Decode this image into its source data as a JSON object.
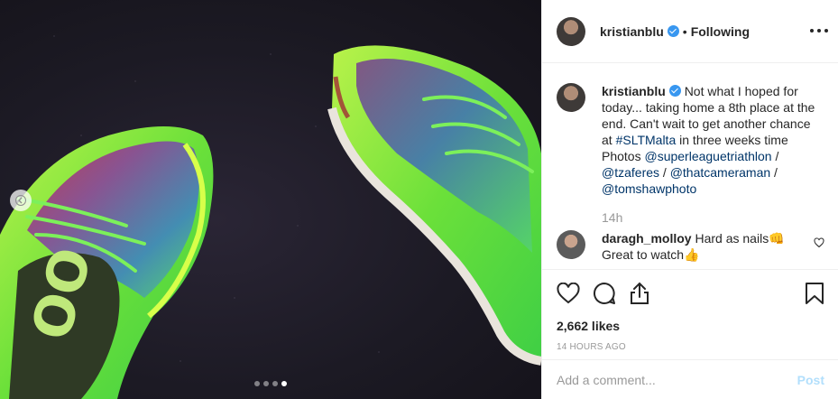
{
  "photo": {
    "carousel": {
      "total": 4,
      "active": 4
    },
    "icons": {
      "prev": "chevron-left-icon"
    }
  },
  "post": {
    "author": "kristianblu",
    "verified": true,
    "separator": "•",
    "follow_status": "Following",
    "more_icon": "more-options-icon"
  },
  "caption": {
    "author": "kristianblu",
    "text_parts": [
      {
        "type": "text",
        "value": "Not what I hoped for today... taking home a 8th place at the end. Can't wait to get another chance at "
      },
      {
        "type": "link",
        "value": "#SLTMalta"
      },
      {
        "type": "text",
        "value": " in three weeks time Photos "
      },
      {
        "type": "link",
        "value": "@superleaguetriathlon"
      },
      {
        "type": "text",
        "value": " / "
      },
      {
        "type": "link",
        "value": "@tzaferes"
      },
      {
        "type": "text",
        "value": " / "
      },
      {
        "type": "link",
        "value": "@thatcameraman"
      },
      {
        "type": "text",
        "value": " / "
      },
      {
        "type": "link",
        "value": "@tomshawphoto"
      }
    ],
    "time": "14h"
  },
  "comments": [
    {
      "author": "daragh_molloy",
      "text": "Hard as nails👊 Great to watch👍",
      "like_icon": "heart-outline-icon"
    }
  ],
  "actions": {
    "icons": [
      "heart-icon",
      "comment-icon",
      "share-icon",
      "bookmark-icon"
    ],
    "likes": "2,662 likes",
    "ago": "14 HOURS AGO"
  },
  "add_comment": {
    "placeholder": "Add a comment...",
    "submit": "Post"
  },
  "colors": {
    "verified": "#3897f0",
    "link": "#003569",
    "post_disabled": "#b2dffc",
    "muted": "#999999"
  }
}
